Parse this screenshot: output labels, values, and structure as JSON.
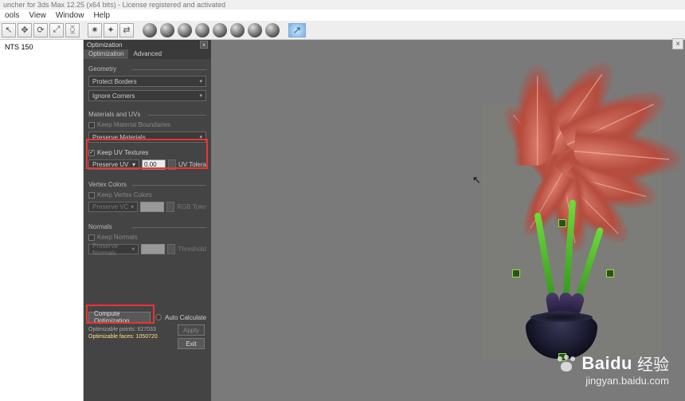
{
  "app": {
    "title": "uncher for 3ds Max 12.25 (x64 bits) - License registered and activated"
  },
  "menu": {
    "items": [
      "ools",
      "View",
      "Window",
      "Help"
    ]
  },
  "sidebar": {
    "obj_label": "NTS 150"
  },
  "opt": {
    "header": "Optimization",
    "tabs": {
      "opt": "Optimization",
      "adv": "Advanced"
    },
    "geometry": {
      "label": "Geometry",
      "protect_borders": "Protect Borders",
      "ignore_corners": "Ignore Corners"
    },
    "materials": {
      "label": "Materials and UVs",
      "keep_mat": "Keep Material Boundaries",
      "preserve_mat": "Preserve Materials",
      "keep_uv": "Keep UV Textures",
      "preserve_uv": "Preserve UV",
      "uv_val": "0.00",
      "uv_toler": "UV Tolera"
    },
    "vc": {
      "label": "Vertex Colors",
      "keep_vc": "Keep Vertex Colors",
      "preserve_vc": "Preserve VC",
      "rgb_toler": "RGB Toler"
    },
    "normals": {
      "label": "Normals",
      "keep_n": "Keep Normals",
      "preserve_n": "Preserve Normals",
      "thresh": "Threshold"
    },
    "compute": "Compute Optimization",
    "auto_calc": "Auto Calculate",
    "apply": "Apply",
    "exit": "Exit",
    "stats": {
      "l1": "Optimizable points:  627033",
      "l2": "Optimizable faces:  1050720"
    }
  },
  "watermark": {
    "brand": "Baidu",
    "cn": "经验",
    "url": "jingyan.baidu.com"
  }
}
